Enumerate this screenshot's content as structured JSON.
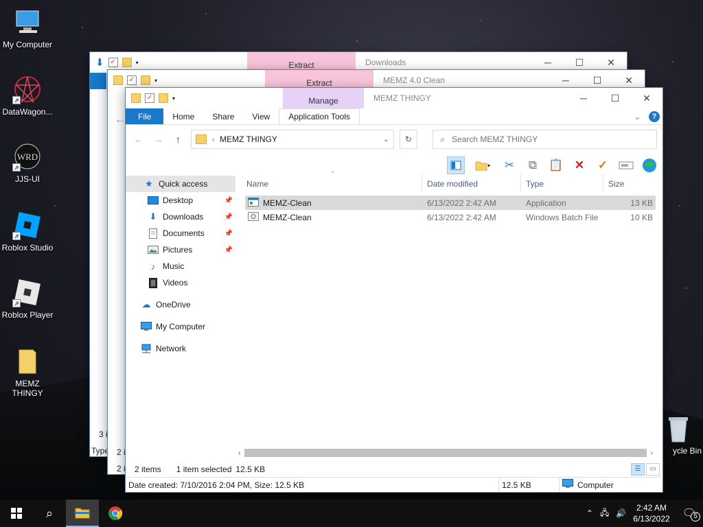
{
  "desktop_icons": [
    {
      "label": "My Computer",
      "icon": "computer-icon"
    },
    {
      "label": "DataWagon...",
      "icon": "datawagon-icon"
    },
    {
      "label": "JJS-UI",
      "icon": "jjs-ui-icon"
    },
    {
      "label": "Roblox Studio",
      "icon": "roblox-studio-icon"
    },
    {
      "label": "Roblox Player",
      "icon": "roblox-player-icon"
    },
    {
      "label": "MEMZ THINGY",
      "icon": "folder-icon"
    },
    {
      "label": "ycle Bin",
      "icon": "recycle-bin-icon"
    }
  ],
  "back_window_1": {
    "context_tab": "Extract",
    "title": "Downloads",
    "status_partial": "3 i",
    "type_partial": "Type"
  },
  "back_window_2": {
    "context_tab": "Extract",
    "title": "MEMZ 4.0 Clean",
    "status_partial": "2 i",
    "item_partial": "2 ite"
  },
  "front_window": {
    "context_tab_group": "Manage",
    "title": "MEMZ THINGY",
    "tabs": [
      "File",
      "Home",
      "Share",
      "View",
      "Application Tools"
    ],
    "address_path": "MEMZ THINGY",
    "search_placeholder": "Search MEMZ THINGY",
    "nav": {
      "quick_access": "Quick access",
      "items": [
        {
          "label": "Desktop",
          "icon": "desktop-icon",
          "pinned": true
        },
        {
          "label": "Downloads",
          "icon": "download-icon",
          "pinned": true
        },
        {
          "label": "Documents",
          "icon": "documents-icon",
          "pinned": true
        },
        {
          "label": "Pictures",
          "icon": "pictures-icon",
          "pinned": true
        },
        {
          "label": "Music",
          "icon": "music-icon",
          "pinned": false
        },
        {
          "label": "Videos",
          "icon": "videos-icon",
          "pinned": false
        }
      ],
      "onedrive": "OneDrive",
      "my_computer": "My Computer",
      "network": "Network"
    },
    "columns": [
      "Name",
      "Date modified",
      "Type",
      "Size"
    ],
    "files": [
      {
        "name": "MEMZ-Clean",
        "date": "6/13/2022 2:42 AM",
        "type": "Application",
        "size": "13 KB",
        "selected": true
      },
      {
        "name": "MEMZ-Clean",
        "date": "6/13/2022 2:42 AM",
        "type": "Windows Batch File",
        "size": "10 KB",
        "selected": false
      }
    ],
    "status": {
      "items": "2 items",
      "selected": "1 item selected",
      "size": "12.5 KB"
    },
    "infobar": {
      "details": "Date created: 7/10/2016 2:04 PM, Size: 12.5 KB",
      "size": "12.5 KB",
      "location": "Computer"
    }
  },
  "taskbar": {
    "time": "2:42 AM",
    "date": "6/13/2022",
    "notifications": "5"
  }
}
